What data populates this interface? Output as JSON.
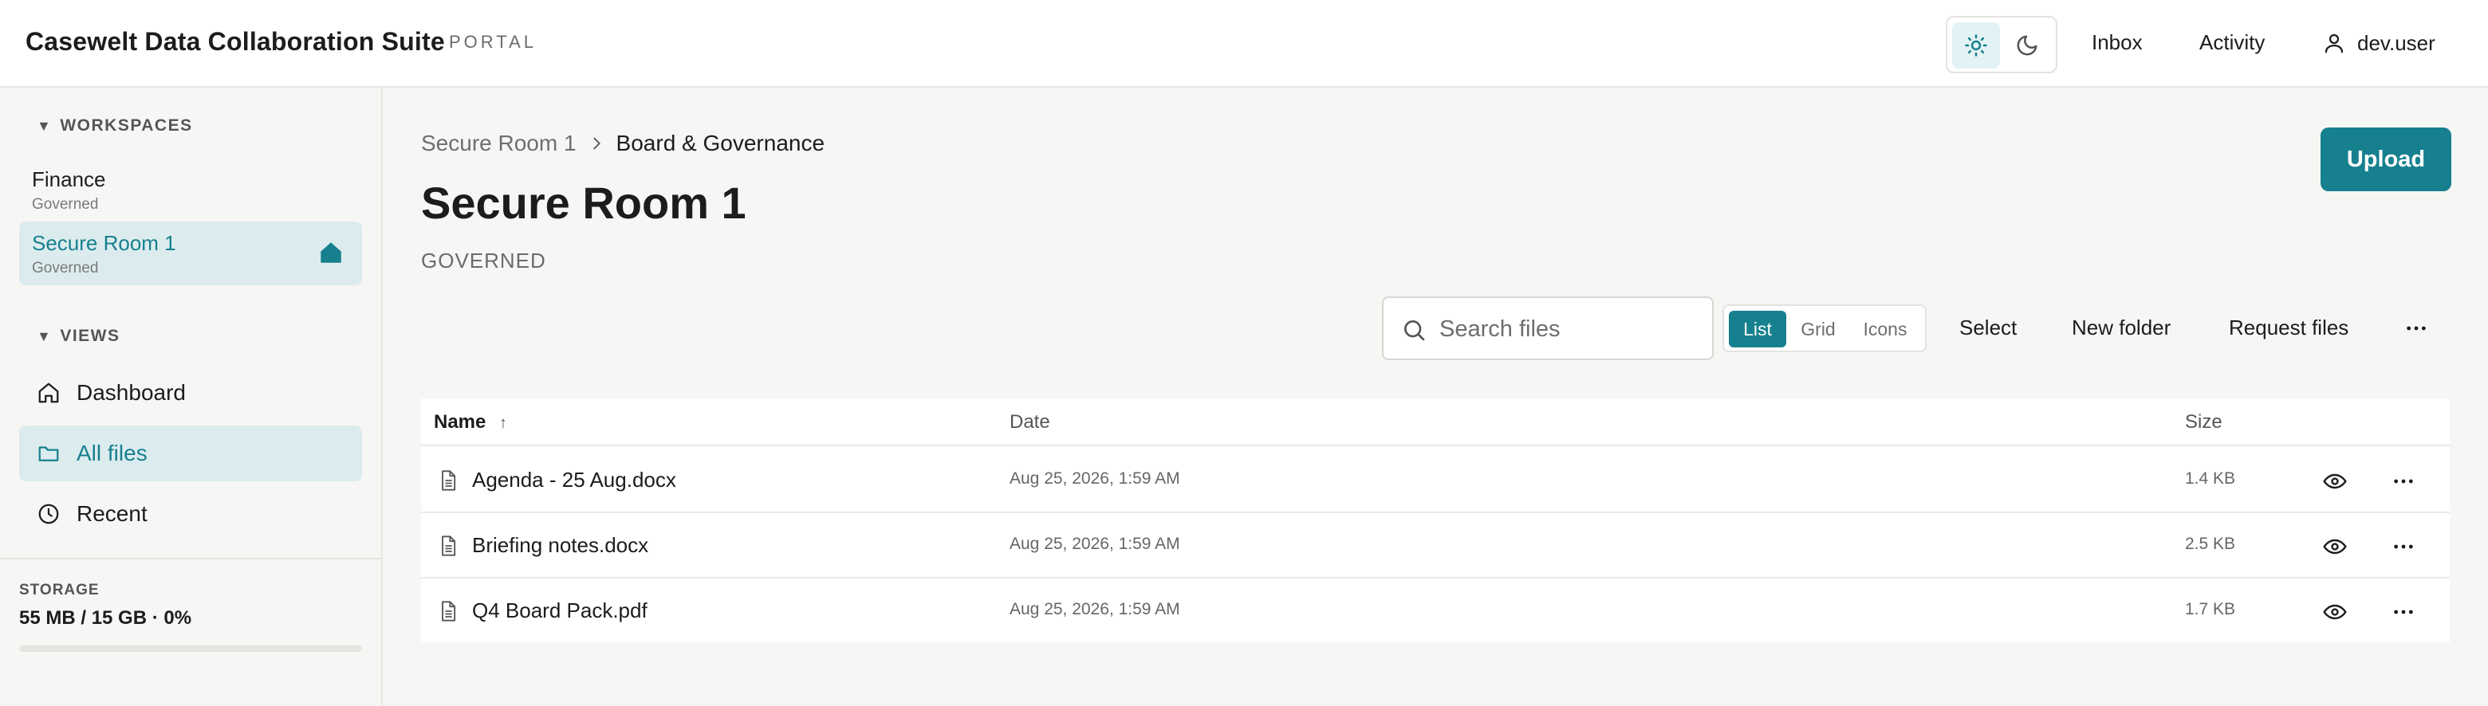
{
  "header": {
    "brand": "Casewelt Data Collaboration Suite",
    "tag": "PORTAL",
    "nav": [
      "Inbox",
      "Activity"
    ],
    "user": "dev.user",
    "theme": "light"
  },
  "sidebar": {
    "workspaces_label": "WORKSPACES",
    "workspaces": [
      {
        "name": "Finance",
        "sub": "Governed",
        "active": false
      },
      {
        "name": "Secure Room 1",
        "sub": "Governed",
        "active": true
      }
    ],
    "views_label": "VIEWS",
    "views": [
      {
        "label": "Dashboard",
        "icon": "home-icon",
        "active": false
      },
      {
        "label": "All files",
        "icon": "folder-icon",
        "active": true
      },
      {
        "label": "Recent",
        "icon": "clock-icon",
        "active": false
      }
    ],
    "storage_label": "STORAGE",
    "storage_value": "55 MB / 15 GB · 0%",
    "storage_percent": 0
  },
  "main": {
    "breadcrumb": [
      "Secure Room 1",
      "Board & Governance"
    ],
    "title": "Secure Room 1",
    "subtitle": "GOVERNED",
    "upload_label": "Upload",
    "search_placeholder": "Search files",
    "view_modes": [
      "List",
      "Grid",
      "Icons"
    ],
    "active_view": "List",
    "actions": [
      "Select",
      "New folder",
      "Request files"
    ]
  },
  "table": {
    "columns": {
      "name": "Name",
      "sort_indicator": "↑",
      "date": "Date",
      "size": "Size"
    },
    "rows": [
      {
        "name": "Agenda - 25 Aug.docx",
        "date": "Aug 25, 2026, 1:59 AM",
        "size": "1.4 KB"
      },
      {
        "name": "Briefing notes.docx",
        "date": "Aug 25, 2026, 1:59 AM",
        "size": "2.5 KB"
      },
      {
        "name": "Q4 Board Pack.pdf",
        "date": "Aug 25, 2026, 1:59 AM",
        "size": "1.7 KB"
      }
    ]
  },
  "colors": {
    "accent": "#17808f",
    "accent_soft": "#dcecee"
  }
}
